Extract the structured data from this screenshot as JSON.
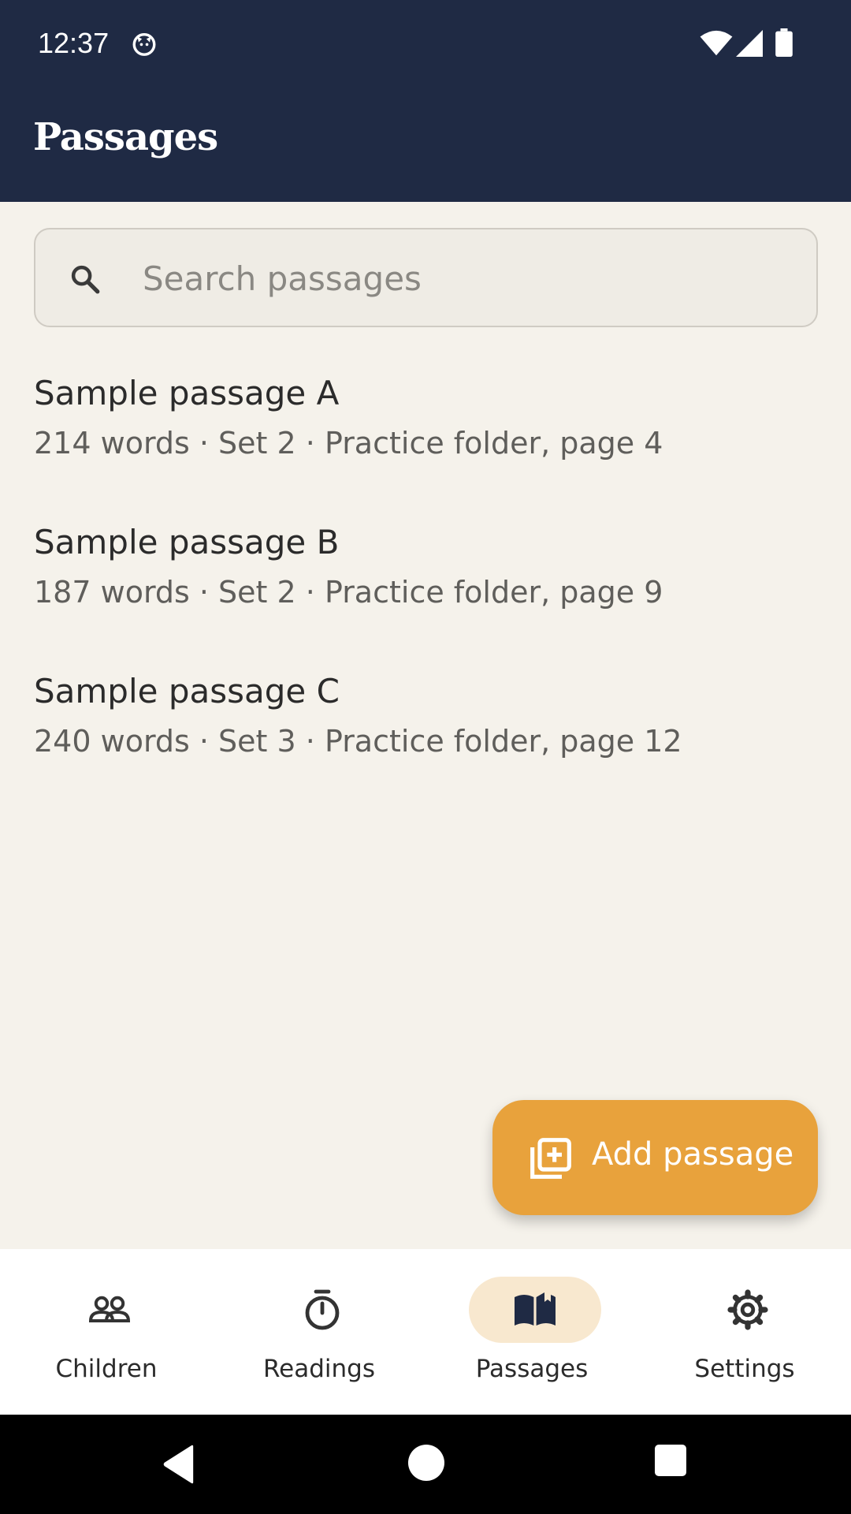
{
  "status_bar": {
    "time": "12:37"
  },
  "app_bar": {
    "title": "Passages"
  },
  "search": {
    "placeholder": "Search passages"
  },
  "passages": [
    {
      "name": "Sample passage A",
      "meta": "214 words · Set 2 · Practice folder, page 4"
    },
    {
      "name": "Sample passage B",
      "meta": "187 words · Set 2 · Practice folder, page 9"
    },
    {
      "name": "Sample passage C",
      "meta": "240 words · Set 3 · Practice folder, page 12"
    }
  ],
  "fab": {
    "label": "Add passage",
    "icon": "add-library-icon",
    "color": "#e8a23c"
  },
  "bottom_nav": {
    "items": [
      {
        "label": "Children",
        "icon": "people-icon",
        "active": false
      },
      {
        "label": "Readings",
        "icon": "stopwatch-icon",
        "active": false
      },
      {
        "label": "Passages",
        "icon": "book-icon",
        "active": true
      },
      {
        "label": "Settings",
        "icon": "gear-icon",
        "active": false
      }
    ]
  },
  "colors": {
    "header": "#1f2a44",
    "background": "#f5f2eb",
    "accent": "#e8a23c",
    "active_pill": "#f8e8cf"
  }
}
